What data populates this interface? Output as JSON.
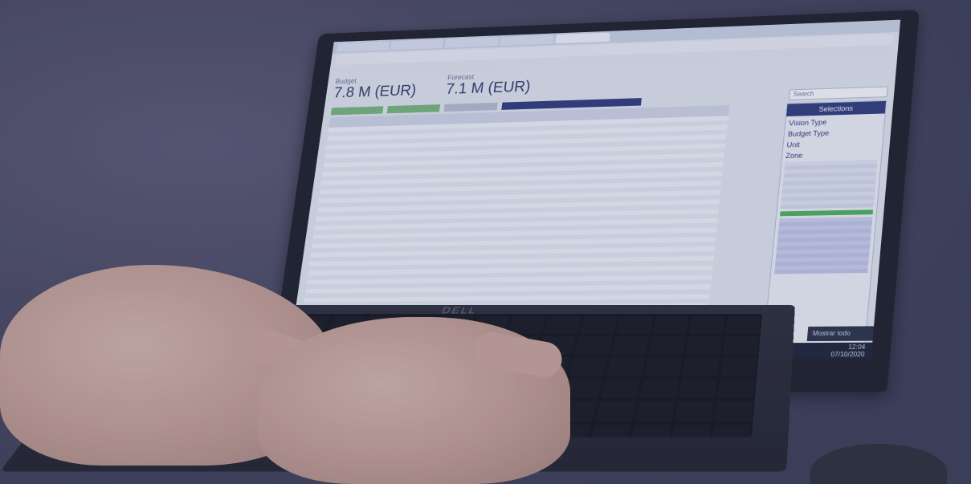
{
  "photo": {
    "subject": "Hands typing on a laptop showing a budget dashboard",
    "tint_color": "#3c4678"
  },
  "screen": {
    "kpis": [
      {
        "label": "Budget",
        "value": "7.8 M (EUR)"
      },
      {
        "label": "Forecast",
        "value": "7.1 M (EUR)"
      }
    ],
    "search_placeholder": "Search",
    "side_panel": {
      "title": "Selections",
      "sections": [
        "Vision Type",
        "Budget Type",
        "Unit",
        "Zone"
      ]
    },
    "notification": "Mostrar todo",
    "clock_time": "12:04",
    "clock_date": "07/10/2020"
  },
  "laptop": {
    "brand": "DELL"
  }
}
